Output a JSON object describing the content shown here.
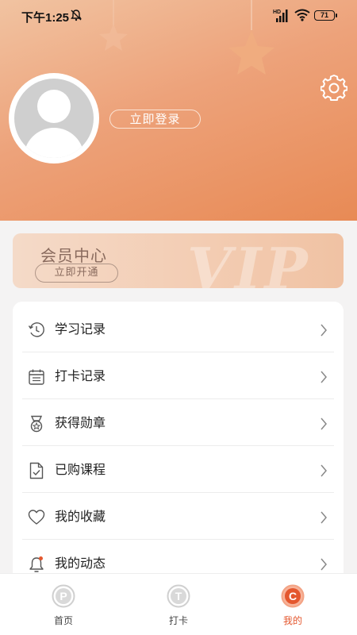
{
  "status_bar": {
    "time": "下午1:25",
    "battery": "71",
    "network_label": "HD"
  },
  "profile": {
    "login_label": "立即登录"
  },
  "vip": {
    "title": "会员中心",
    "open_label": "立即开通",
    "watermark": "VIP"
  },
  "menu": {
    "items": [
      {
        "label": "学习记录",
        "icon": "clock-history-icon"
      },
      {
        "label": "打卡记录",
        "icon": "calendar-icon"
      },
      {
        "label": "获得勋章",
        "icon": "medal-icon"
      },
      {
        "label": "已购课程",
        "icon": "document-check-icon"
      },
      {
        "label": "我的收藏",
        "icon": "heart-icon"
      },
      {
        "label": "我的动态",
        "icon": "bell-icon"
      }
    ]
  },
  "nav": {
    "items": [
      {
        "label": "首页",
        "glyph": "P"
      },
      {
        "label": "打卡",
        "glyph": "T"
      },
      {
        "label": "我的",
        "glyph": "C"
      }
    ],
    "active_index": 2
  },
  "colors": {
    "header_start": "#f1c3a1",
    "header_end": "#e88a55",
    "accent": "#e4572e",
    "vip_text": "#8a6b5e"
  }
}
